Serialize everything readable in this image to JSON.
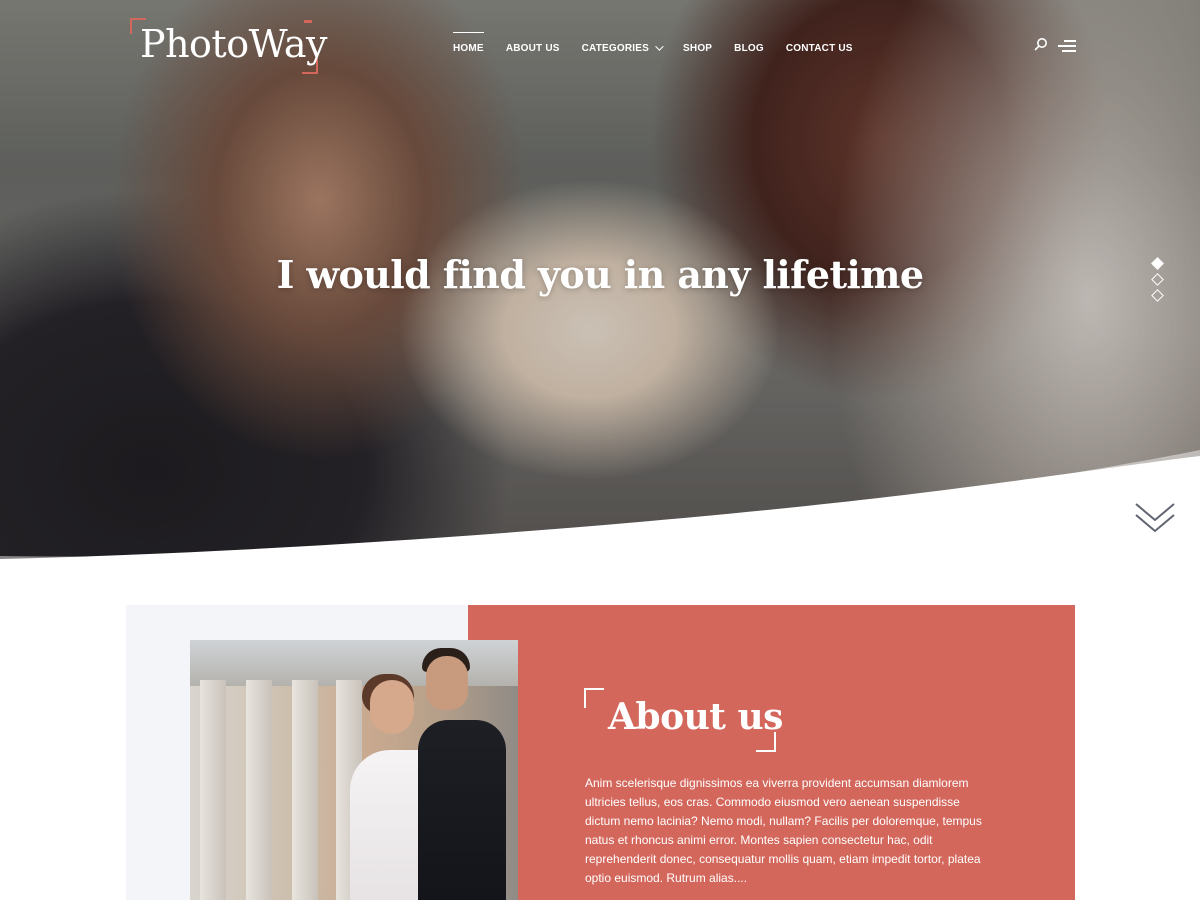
{
  "brand": {
    "name": "PhotoWay",
    "accent_color": "#d4675c"
  },
  "nav": {
    "items": [
      {
        "label": "HOME",
        "active": true
      },
      {
        "label": "ABOUT US"
      },
      {
        "label": "CATEGORIES",
        "has_dropdown": true
      },
      {
        "label": "SHOP"
      },
      {
        "label": "BLOG"
      },
      {
        "label": "CONTACT US"
      }
    ],
    "icons": [
      "search-icon",
      "menu-icon"
    ]
  },
  "hero": {
    "headline": "I would find you in any lifetime",
    "slider": {
      "count": 3,
      "active_index": 0
    },
    "scroll_icon": "double-chevron-down-icon"
  },
  "about": {
    "title": "About us",
    "text": "Anim scelerisque dignissimos ea viverra provident accumsan diamlorem ultricies tellus, eos cras. Commodo eiusmod vero aenean suspendisse dictum nemo lacinia? Nemo modi, nullam? Facilis per doloremque, tempus natus et rhoncus animi error. Montes sapien consectetur hac, odit reprehenderit donec, consequatur mollis quam, etiam impedit tortor, platea optio euismod. Rutrum alias....",
    "panel_color": "#d4675c"
  }
}
